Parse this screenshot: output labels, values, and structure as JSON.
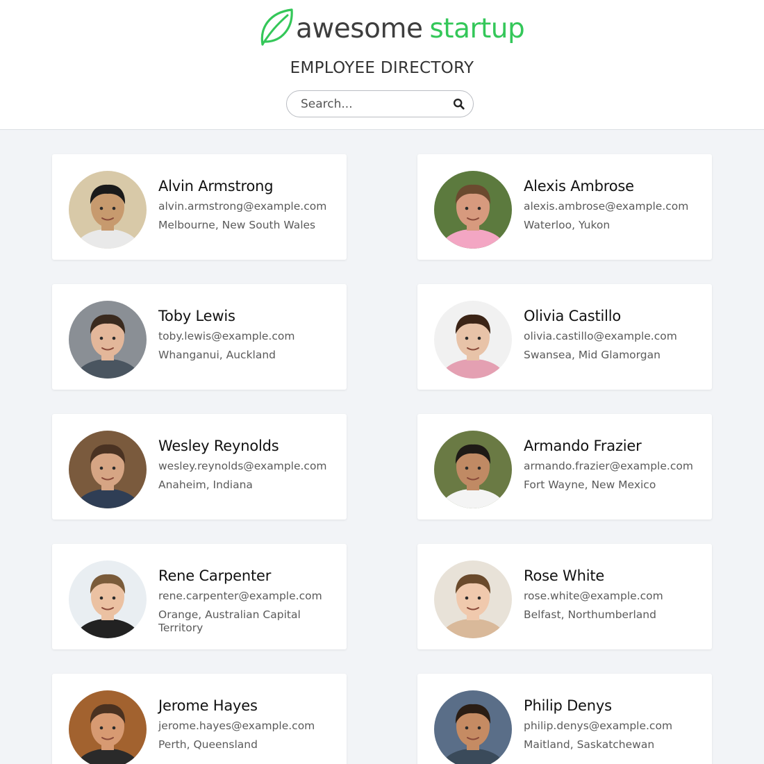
{
  "brand": {
    "word1": "awesome",
    "word2": "startup",
    "accent": "#34c759",
    "icon": "leaf-icon"
  },
  "page_title": "EMPLOYEE DIRECTORY",
  "search": {
    "placeholder": "Search...",
    "value": "",
    "icon": "search-icon"
  },
  "employees": [
    {
      "name": "Alvin Armstrong",
      "email": "alvin.armstrong@example.com",
      "location": "Melbourne, New South Wales",
      "skin": "#c79a6e",
      "hair": "#1a1a1a",
      "bg": "#d8c9a8",
      "shirt": "#e9e9e9"
    },
    {
      "name": "Alexis Ambrose",
      "email": "alexis.ambrose@example.com",
      "location": "Waterloo, Yukon",
      "skin": "#d79a7e",
      "hair": "#6b4a2f",
      "bg": "#5c7a3e",
      "shirt": "#f3a6c3"
    },
    {
      "name": "Toby Lewis",
      "email": "toby.lewis@example.com",
      "location": "Whanganui, Auckland",
      "skin": "#e3b79a",
      "hair": "#3a2a1e",
      "bg": "#8a8f95",
      "shirt": "#4a5560"
    },
    {
      "name": "Olivia Castillo",
      "email": "olivia.castillo@example.com",
      "location": "Swansea, Mid Glamorgan",
      "skin": "#e8c3a8",
      "hair": "#3b2416",
      "bg": "#f1f1f1",
      "shirt": "#e4a0b2"
    },
    {
      "name": "Wesley Reynolds",
      "email": "wesley.reynolds@example.com",
      "location": "Anaheim, Indiana",
      "skin": "#d6a584",
      "hair": "#4a3222",
      "bg": "#7a5a3d",
      "shirt": "#2f3e55"
    },
    {
      "name": "Armando Frazier",
      "email": "armando.frazier@example.com",
      "location": "Fort Wayne, New Mexico",
      "skin": "#c08a64",
      "hair": "#1e1a16",
      "bg": "#6a7a44",
      "shirt": "#f4f4f4"
    },
    {
      "name": "Rene Carpenter",
      "email": "rene.carpenter@example.com",
      "location": "Orange, Australian Capital Territory",
      "skin": "#ebc1a2",
      "hair": "#7a5b3a",
      "bg": "#e9eef2",
      "shirt": "#222222"
    },
    {
      "name": "Rose White",
      "email": "rose.white@example.com",
      "location": "Belfast, Northumberland",
      "skin": "#f0c9ad",
      "hair": "#6a4a2c",
      "bg": "#e8e2d8",
      "shirt": "#d9b99a"
    },
    {
      "name": "Jerome Hayes",
      "email": "jerome.hayes@example.com",
      "location": "Perth, Queensland",
      "skin": "#d79a72",
      "hair": "#4a3120",
      "bg": "#a2622f",
      "shirt": "#2a2a2a"
    },
    {
      "name": "Philip Denys",
      "email": "philip.denys@example.com",
      "location": "Maitland, Saskatchewan",
      "skin": "#c58b63",
      "hair": "#2a1d14",
      "bg": "#5a6e88",
      "shirt": "#3a4a5a"
    }
  ]
}
